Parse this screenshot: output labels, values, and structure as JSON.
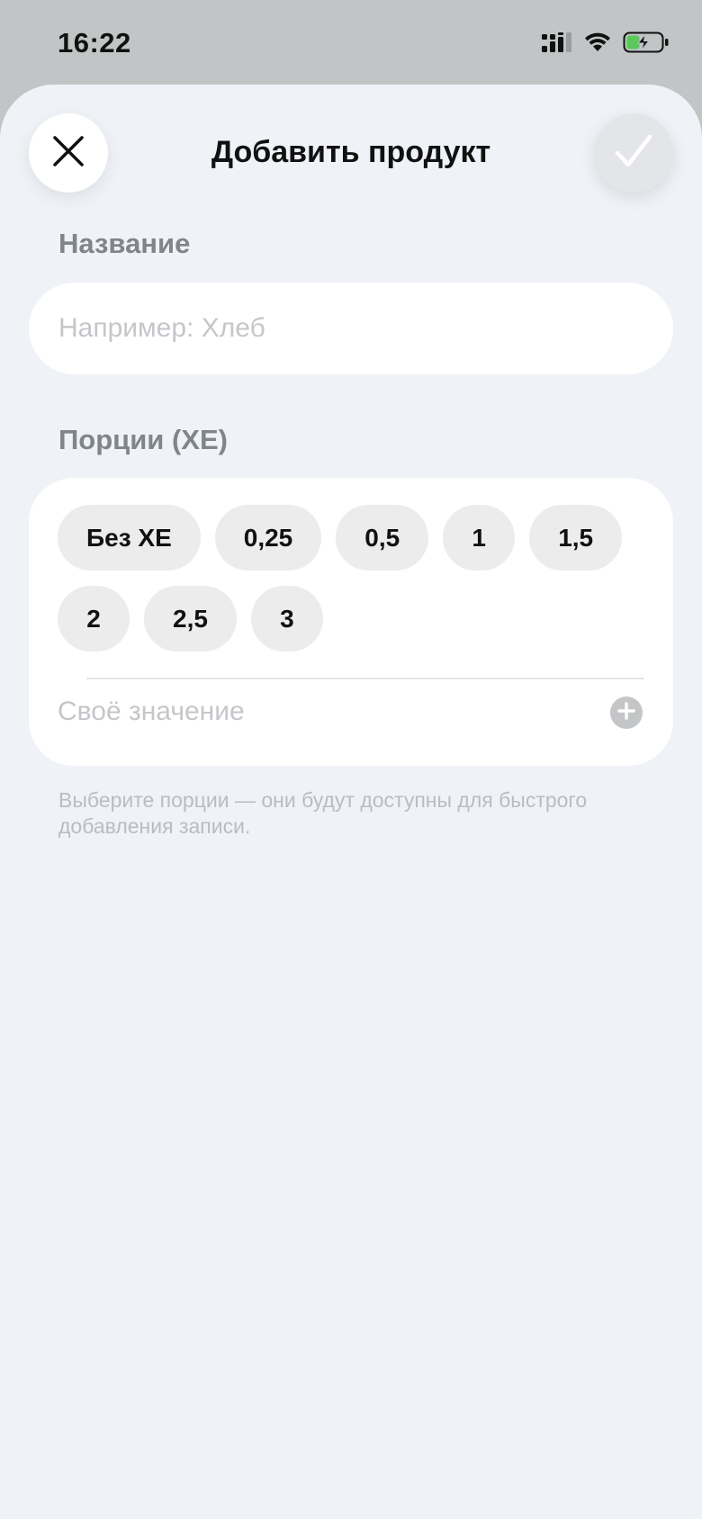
{
  "status_bar": {
    "time": "16:22",
    "icons": [
      "cellular-signal-icon",
      "wifi-icon",
      "battery-charging-icon"
    ]
  },
  "sheet": {
    "title": "Добавить продукт",
    "close_icon": "close-icon",
    "confirm_icon": "checkmark-icon"
  },
  "name_section": {
    "label": "Название",
    "value": "",
    "placeholder": "Например: Хлеб"
  },
  "portions_section": {
    "label": "Порции (ХЕ)",
    "chips": [
      "Без ХЕ",
      "0,25",
      "0,5",
      "1",
      "1,5",
      "2",
      "2,5",
      "3"
    ],
    "custom_value_label": "Своё значение",
    "add_icon": "plus-circle-icon",
    "hint": "Выберите порции — они будут доступны для быстрого добавления записи."
  },
  "colors": {
    "backdrop": "#c1c5c6",
    "sheet_background": "#eff2f6",
    "chip_background": "#ececec",
    "label_gray": "#808589",
    "placeholder_gray": "#c4c6c9",
    "battery_green": "#5ac85a"
  }
}
